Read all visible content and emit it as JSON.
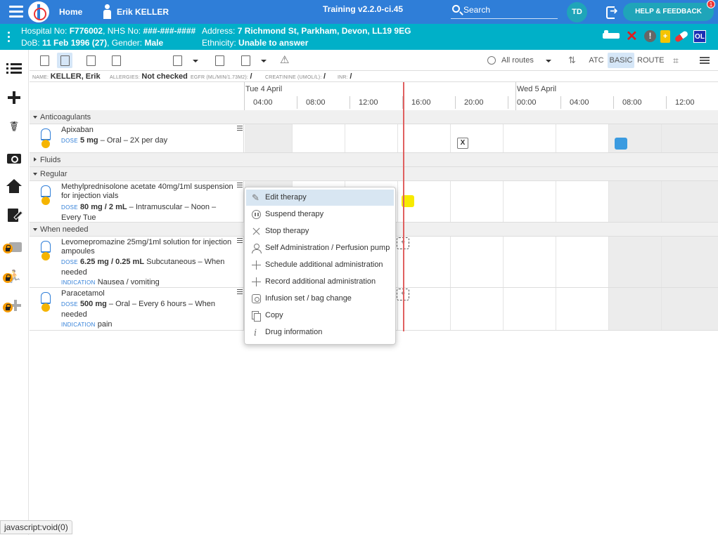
{
  "header": {
    "home_label": "Home",
    "patient_name": "Erik KELLER",
    "version": "Training v2.2.0-ci.45",
    "search_label": "Search",
    "user_initials": "TD",
    "help_label": "HELP & FEEDBACK",
    "help_badge": "1"
  },
  "banner": {
    "hospital_label": "Hospital No:",
    "hospital_no": "F776002",
    "nhs_label": "NHS No:",
    "nhs_no": "###-###-####",
    "dob_label": "DoB:",
    "dob": "11 Feb 1996 (27)",
    "gender_label": "Gender:",
    "gender": "Male",
    "address_label": "Address:",
    "address": "7 Richmond St, Parkham, Devon, LL19 9EG",
    "ethnicity_label": "Ethnicity:",
    "ethnicity": "Unable to answer",
    "alert_icon_text": "!",
    "ol_badge": "OL"
  },
  "toolbar": {
    "routes_label": "All routes",
    "atc_label": "ATC",
    "basic_label": "BASIC",
    "route_label": "ROUTE"
  },
  "info": {
    "name_label": "NAME:",
    "name": "KELLER, Erik",
    "allergies_label": "ALLERGIES:",
    "allergies": "Not checked",
    "egfr_label": "EGFR (ML/MIN/1.73M2):",
    "egfr": "/",
    "creatinine_label": "CREATININE (UMOL/L):",
    "creatinine": "/",
    "inr_label": "INR:",
    "inr": "/"
  },
  "timeline": {
    "dates": [
      "Tue 4 April",
      "Wed 5 April"
    ],
    "hours": [
      "04:00",
      "08:00",
      "12:00",
      "16:00",
      "20:00",
      "00:00",
      "04:00",
      "08:00",
      "12:00"
    ]
  },
  "sections": {
    "anticoagulants": "Anticoagulants",
    "fluids": "Fluids",
    "regular": "Regular",
    "when_needed": "When needed"
  },
  "meds": {
    "apixaban": {
      "name": "Apixaban",
      "dose_kw": "DOSE",
      "dose": "5 mg",
      "rest": "– Oral – 2X per day",
      "admin_mark": "X"
    },
    "methylpred": {
      "name": "Methylprednisolone acetate 40mg/1ml suspension for injection vials",
      "dose_kw": "DOSE",
      "dose": "80 mg / 2 mL",
      "rest": "– Intramuscular – Noon – Every Tue"
    },
    "levomep": {
      "name": "Levomepromazine 25mg/1ml solution for injection ampoules",
      "dose_kw": "DOSE",
      "dose": "6.25 mg / 0.25 mL",
      "rest": "Subcutaneous – When needed",
      "indication_kw": "INDICATION",
      "indication": "Nausea / vomiting",
      "admin_mark": "+"
    },
    "paracetamol": {
      "name": "Paracetamol",
      "dose_kw": "DOSE",
      "dose": "500 mg",
      "rest": "– Oral – Every 6 hours – When needed",
      "indication_kw": "INDICATION",
      "indication": "pain",
      "admin_mark": "+"
    }
  },
  "context_menu": {
    "items": [
      "Edit therapy",
      "Suspend therapy",
      "Stop therapy",
      "Self Administration / Perfusion pump",
      "Schedule additional administration",
      "Record additional administration",
      "Infusion set / bag change",
      "Copy",
      "Drug information"
    ]
  },
  "status": {
    "link": "javascript:void(0)"
  },
  "colors": {
    "topbar": "#2f7ed8",
    "banner": "#00b0c8",
    "accent_teal": "#1fa5b9",
    "now_line": "#e06060",
    "admin_done": "#3b9be0",
    "admin_due": "#f7ea00"
  }
}
